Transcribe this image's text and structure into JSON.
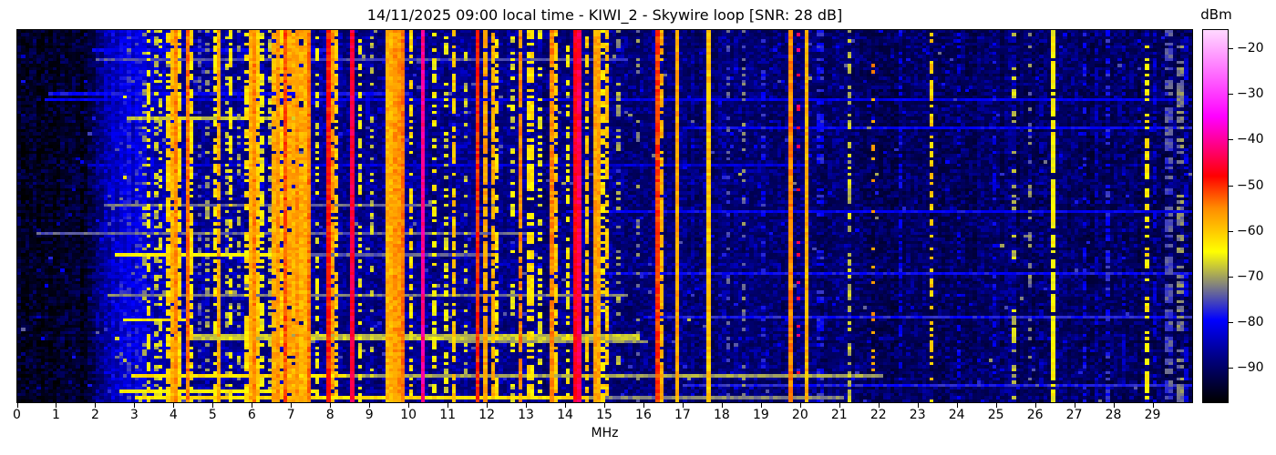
{
  "header": {
    "title": "14/11/2025 09:00 local time - KIWI_2 - Skywire loop [SNR: 28 dB]",
    "date": "14/11/2025",
    "time": "09:00 local time",
    "receiver": "KIWI_2",
    "antenna": "Skywire loop",
    "snr": "28 dB"
  },
  "axes": {
    "xlabel": "MHz",
    "colorbar_label": "dBm"
  },
  "chart_data": {
    "type": "heatmap",
    "title": "14/11/2025 09:00 local time - KIWI_2 - Skywire loop [SNR: 28 dB]",
    "xlabel": "MHz",
    "colorbar_label": "dBm",
    "x_range_mhz": [
      0,
      30
    ],
    "x_ticks": [
      0,
      1,
      2,
      3,
      4,
      5,
      6,
      7,
      8,
      9,
      10,
      11,
      12,
      13,
      14,
      15,
      16,
      17,
      18,
      19,
      20,
      21,
      22,
      23,
      24,
      25,
      26,
      27,
      28,
      29
    ],
    "colorbar_ticks": [
      -20,
      -30,
      -40,
      -50,
      -60,
      -70,
      -80,
      -90
    ],
    "value_scale_dbm": {
      "vmin": -97.5,
      "vmax": -16
    },
    "colormap_anchors": [
      {
        "value": -97.5,
        "color": "#000000"
      },
      {
        "value": -88.0,
        "color": "#000080"
      },
      {
        "value": -79.5,
        "color": "#0000ff"
      },
      {
        "value": -64.5,
        "color": "#ffff00"
      },
      {
        "value": -55.0,
        "color": "#ff8c00"
      },
      {
        "value": -48.0,
        "color": "#ff0000"
      },
      {
        "value": -35.0,
        "color": "#ff00ff"
      },
      {
        "value": -16.0,
        "color": "#ffd9ff"
      }
    ],
    "grid": false,
    "legend": "none",
    "noise_floor_profile": [
      [
        0.0,
        -96.5
      ],
      [
        1.7,
        -96.5
      ],
      [
        2.3,
        -86.0
      ],
      [
        2.8,
        -84.0
      ],
      [
        3.3,
        -85.0
      ],
      [
        4.2,
        -89.0
      ],
      [
        8.0,
        -89.5
      ],
      [
        15.0,
        -90.5
      ],
      [
        20.0,
        -91.5
      ],
      [
        22.0,
        -92.5
      ],
      [
        30.0,
        -92.5
      ]
    ],
    "stations_format": [
      "freq_mhz",
      "level_dbm",
      "duty",
      "width_cols"
    ],
    "stations": [
      [
        3.2,
        -70,
        0.35,
        1
      ],
      [
        3.33,
        -63,
        0.6,
        1
      ],
      [
        3.5,
        -68,
        0.4,
        1
      ],
      [
        3.62,
        -66,
        0.4,
        1
      ],
      [
        3.8,
        -61,
        0.7,
        1
      ],
      [
        3.88,
        -58,
        0.9,
        1
      ],
      [
        3.95,
        -55,
        1,
        1
      ],
      [
        4.05,
        -61,
        0.8,
        1
      ],
      [
        4.27,
        -54,
        1,
        1
      ],
      [
        4.35,
        -62,
        0.6,
        1
      ],
      [
        4.55,
        -74,
        0.3,
        1
      ],
      [
        4.75,
        -70,
        0.3,
        1
      ],
      [
        5.0,
        -63,
        0.5,
        1
      ],
      [
        5.06,
        -57,
        0.9,
        1
      ],
      [
        5.3,
        -68,
        0.4,
        1
      ],
      [
        5.4,
        -63,
        0.5,
        1
      ],
      [
        5.6,
        -70,
        0.3,
        1
      ],
      [
        5.75,
        -62,
        0.6,
        1
      ],
      [
        5.85,
        -58,
        1,
        2
      ],
      [
        6.0,
        -55,
        1,
        1
      ],
      [
        6.07,
        -60,
        0.9,
        1
      ],
      [
        6.18,
        -65,
        0.5,
        1
      ],
      [
        6.35,
        -68,
        0.4,
        1
      ],
      [
        6.5,
        -58,
        0.9,
        1
      ],
      [
        6.6,
        -56,
        1,
        1
      ],
      [
        6.7,
        -60,
        0.8,
        2
      ],
      [
        6.8,
        -52,
        1,
        1
      ],
      [
        6.9,
        -57,
        0.9,
        1
      ],
      [
        7.0,
        -58,
        0.9,
        1
      ],
      [
        7.1,
        -56,
        1,
        1
      ],
      [
        7.2,
        -58,
        0.9,
        2
      ],
      [
        7.3,
        -60,
        0.8,
        1
      ],
      [
        7.44,
        -54,
        1,
        1
      ],
      [
        7.6,
        -65,
        0.4,
        1
      ],
      [
        7.85,
        -49,
        1,
        1
      ],
      [
        8.0,
        -56,
        0.8,
        1
      ],
      [
        8.1,
        -60,
        0.6,
        1
      ],
      [
        8.47,
        -45,
        1,
        1
      ],
      [
        8.7,
        -65,
        0.4,
        1
      ],
      [
        9.0,
        -68,
        0.3,
        1
      ],
      [
        9.4,
        -58,
        1,
        2
      ],
      [
        9.55,
        -56,
        1,
        3
      ],
      [
        9.75,
        -54,
        1,
        1
      ],
      [
        10.0,
        -62,
        0.5,
        1
      ],
      [
        10.25,
        -41,
        1,
        1
      ],
      [
        10.6,
        -64,
        0.5,
        1
      ],
      [
        10.9,
        -66,
        0.4,
        1
      ],
      [
        11.1,
        -60,
        0.7,
        1
      ],
      [
        11.35,
        -68,
        0.3,
        1
      ],
      [
        11.7,
        -50,
        1,
        1
      ],
      [
        11.9,
        -57,
        0.8,
        1
      ],
      [
        12.05,
        -58,
        0.8,
        1
      ],
      [
        12.2,
        -62,
        0.5,
        1
      ],
      [
        12.6,
        -66,
        0.4,
        1
      ],
      [
        12.8,
        -55,
        0.9,
        1
      ],
      [
        13.0,
        -62,
        0.6,
        2
      ],
      [
        13.3,
        -65,
        0.4,
        1
      ],
      [
        13.55,
        -55,
        0.9,
        1
      ],
      [
        13.7,
        -60,
        0.6,
        1
      ],
      [
        14.0,
        -64,
        0.4,
        1
      ],
      [
        14.2,
        -47,
        1,
        1
      ],
      [
        14.33,
        -44,
        1,
        1
      ],
      [
        14.5,
        -60,
        0.7,
        1
      ],
      [
        14.65,
        -57,
        1,
        2
      ],
      [
        14.85,
        -62,
        0.5,
        1
      ],
      [
        15.0,
        -60,
        0.7,
        1
      ],
      [
        15.3,
        -70,
        0.35,
        1
      ],
      [
        15.8,
        -72,
        0.3,
        1
      ],
      [
        16.3,
        -51,
        1,
        1
      ],
      [
        16.42,
        -58,
        0.8,
        1
      ],
      [
        16.8,
        -57,
        1,
        1
      ],
      [
        17.55,
        -60,
        1,
        1
      ],
      [
        18.1,
        -75,
        0.3,
        1
      ],
      [
        18.5,
        -72,
        0.3,
        1
      ],
      [
        19.0,
        -78,
        0.25,
        1
      ],
      [
        19.65,
        -55,
        1,
        1
      ],
      [
        19.9,
        -44,
        0.2,
        1
      ],
      [
        20.1,
        -58,
        1,
        1
      ],
      [
        20.35,
        -78,
        0.4,
        2
      ],
      [
        21.2,
        -68,
        0.45,
        1
      ],
      [
        21.8,
        -56,
        0.2,
        1
      ],
      [
        22.5,
        -80,
        0.3,
        1
      ],
      [
        23.3,
        -60,
        0.5,
        1
      ],
      [
        24.0,
        -82,
        0.3,
        1
      ],
      [
        24.9,
        -80,
        0.3,
        1
      ],
      [
        25.3,
        -86,
        0.6,
        2
      ],
      [
        25.4,
        -68,
        0.3,
        1
      ],
      [
        25.75,
        -72,
        0.3,
        1
      ],
      [
        26.1,
        -85,
        0.5,
        1
      ],
      [
        26.4,
        -64,
        0.85,
        1
      ],
      [
        27.2,
        -80,
        0.3,
        1
      ],
      [
        27.5,
        -85,
        0.5,
        1
      ],
      [
        27.8,
        -78,
        0.35,
        1
      ],
      [
        28.2,
        -84,
        0.4,
        1
      ],
      [
        28.8,
        -63,
        0.45,
        1
      ],
      [
        29.0,
        -83,
        0.5,
        1
      ],
      [
        29.3,
        -75,
        0.5,
        2
      ],
      [
        29.6,
        -72,
        0.5,
        2
      ],
      [
        29.8,
        -82,
        0.5,
        1
      ]
    ],
    "events_format": [
      "time_frac",
      "f0_mhz",
      "f1_mhz",
      "level_dbm",
      "rows"
    ],
    "events": [
      [
        0.049,
        1.9,
        8.0,
        -80,
        1
      ],
      [
        0.078,
        2.0,
        15.5,
        -75,
        1
      ],
      [
        0.164,
        0.8,
        10.0,
        -79,
        1
      ],
      [
        0.181,
        0.7,
        30.0,
        -81,
        1
      ],
      [
        0.232,
        2.8,
        7.2,
        -68,
        1
      ],
      [
        0.262,
        17.0,
        30.0,
        -80,
        1
      ],
      [
        0.359,
        1.8,
        20.0,
        -82,
        1
      ],
      [
        0.469,
        2.2,
        10.5,
        -73,
        1
      ],
      [
        0.487,
        14.0,
        30.0,
        -80,
        1
      ],
      [
        0.543,
        0.5,
        13.0,
        -74,
        1
      ],
      [
        0.609,
        2.5,
        6.8,
        -64,
        1
      ],
      [
        0.609,
        6.8,
        12.0,
        -74,
        1
      ],
      [
        0.653,
        15.0,
        30.0,
        -79,
        1
      ],
      [
        0.714,
        2.3,
        15.5,
        -72,
        1
      ],
      [
        0.77,
        16.0,
        30.0,
        -78,
        1
      ],
      [
        0.78,
        2.7,
        4.3,
        -63,
        1
      ],
      [
        0.824,
        4.4,
        15.8,
        -68,
        2
      ],
      [
        0.839,
        11.0,
        16.0,
        -71,
        1
      ],
      [
        0.929,
        2.9,
        8.3,
        -62,
        1
      ],
      [
        0.929,
        8.3,
        22.0,
        -70,
        1
      ],
      [
        0.958,
        17.0,
        30.0,
        -78,
        1
      ],
      [
        0.971,
        2.6,
        7.6,
        -64,
        1
      ],
      [
        0.988,
        3.0,
        14.5,
        -62,
        1
      ],
      [
        0.988,
        14.5,
        21.0,
        -72,
        1
      ]
    ]
  }
}
